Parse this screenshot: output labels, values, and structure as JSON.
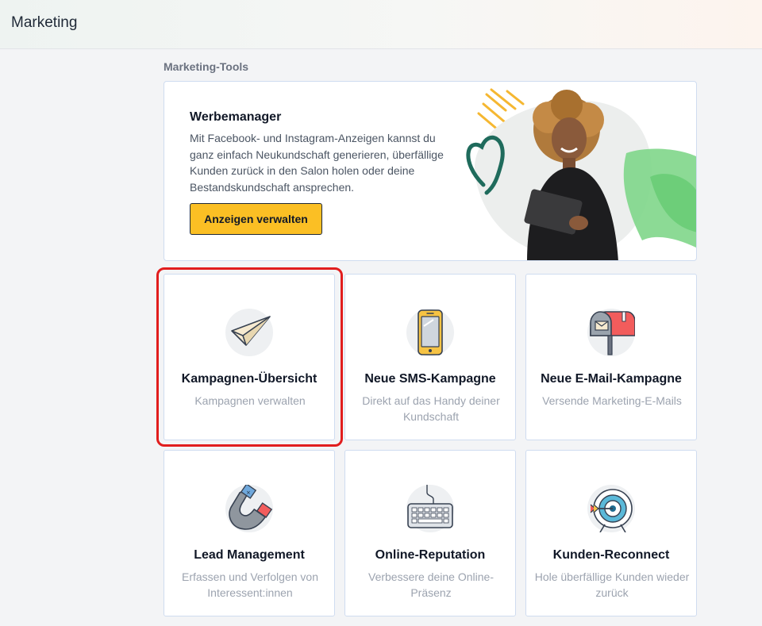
{
  "header": {
    "title": "Marketing"
  },
  "section": {
    "title": "Marketing-Tools"
  },
  "promo": {
    "title": "Werbemanager",
    "text": "Mit Facebook- und Instagram-Anzeigen kannst du ganz einfach Neukundschaft generieren, überfällige Kunden zurück in den Salon holen oder deine Bestandskundschaft ansprechen.",
    "button_label": "Anzeigen verwalten"
  },
  "cards": [
    {
      "title": "Kampagnen-Übersicht",
      "subtitle": "Kampagnen verwalten",
      "icon": "paper-plane-icon"
    },
    {
      "title": "Neue SMS-Kampagne",
      "subtitle": "Direkt auf das Handy deiner Kundschaft",
      "icon": "smartphone-icon"
    },
    {
      "title": "Neue E-Mail-Kampagne",
      "subtitle": "Versende Marketing-E-Mails",
      "icon": "mailbox-icon"
    },
    {
      "title": "Lead Management",
      "subtitle": "Erfassen und Verfolgen von Interessent:innen",
      "icon": "magnet-icon"
    },
    {
      "title": "Online-Reputation",
      "subtitle": "Verbessere deine Online-Präsenz",
      "icon": "keyboard-icon"
    },
    {
      "title": "Kunden-Reconnect",
      "subtitle": "Hole überfällige Kunden wieder zurück",
      "icon": "target-icon"
    }
  ],
  "colors": {
    "accent_button": "#fbbf24",
    "highlight": "#e11d1d",
    "card_border": "#cfdcf0"
  }
}
